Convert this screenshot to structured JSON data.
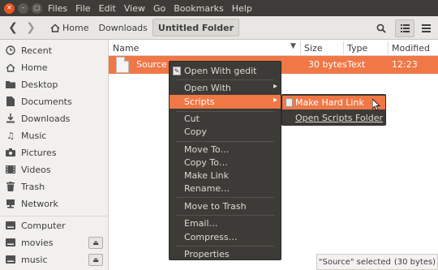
{
  "window": {
    "menus": [
      "Files",
      "File",
      "Edit",
      "View",
      "Go",
      "Bookmarks",
      "Help"
    ]
  },
  "toolbar": {
    "breadcrumbs": [
      {
        "label": "Home",
        "icon": "home-icon"
      },
      {
        "label": "Downloads"
      },
      {
        "label": "Untitled Folder",
        "active": true
      }
    ]
  },
  "sidebar": {
    "items": [
      {
        "label": "Recent",
        "icon": "clock-icon"
      },
      {
        "label": "Home",
        "icon": "home-icon"
      },
      {
        "label": "Desktop",
        "icon": "folder-icon"
      },
      {
        "label": "Documents",
        "icon": "folder-icon"
      },
      {
        "label": "Downloads",
        "icon": "download-icon"
      },
      {
        "label": "Music",
        "icon": "music-icon"
      },
      {
        "label": "Pictures",
        "icon": "camera-icon"
      },
      {
        "label": "Videos",
        "icon": "film-icon"
      },
      {
        "label": "Trash",
        "icon": "trash-icon"
      },
      {
        "label": "Network",
        "icon": "network-icon"
      },
      {
        "label": "Computer",
        "icon": "drive-icon"
      },
      {
        "label": "movies",
        "icon": "usb-drive-icon",
        "eject": true
      },
      {
        "label": "music",
        "icon": "usb-drive-icon",
        "eject": true
      }
    ]
  },
  "filelist": {
    "columns": {
      "name": "Name",
      "size": "Size",
      "type": "Type",
      "modified": "Modified"
    },
    "rows": [
      {
        "name": "Source",
        "size": "30 bytes",
        "type": "Text",
        "modified": "12:23",
        "selected": true
      }
    ]
  },
  "context_menu": {
    "items": [
      {
        "label": "Open With gedit",
        "icon": "gedit-icon"
      },
      {
        "label": "Open With",
        "submenu": true
      },
      {
        "label": "Scripts",
        "submenu": true,
        "highlighted": true
      },
      {
        "label": "Cut"
      },
      {
        "label": "Copy"
      },
      {
        "label": "Move To…"
      },
      {
        "label": "Copy To…"
      },
      {
        "label": "Make Link"
      },
      {
        "label": "Rename…"
      },
      {
        "label": "Move to Trash"
      },
      {
        "label": "Email…"
      },
      {
        "label": "Compress…"
      },
      {
        "label": "Properties"
      }
    ]
  },
  "scripts_submenu": {
    "items": [
      {
        "label": "Make Hard Link",
        "highlighted": true
      },
      {
        "label": "Open Scripts Folder"
      }
    ]
  },
  "status": {
    "selection": "\"Source\" selected",
    "size": "(30 bytes)"
  },
  "colors": {
    "accent": "#f07746",
    "menu_bg": "#3c3b37",
    "close_button": "#e95420"
  }
}
